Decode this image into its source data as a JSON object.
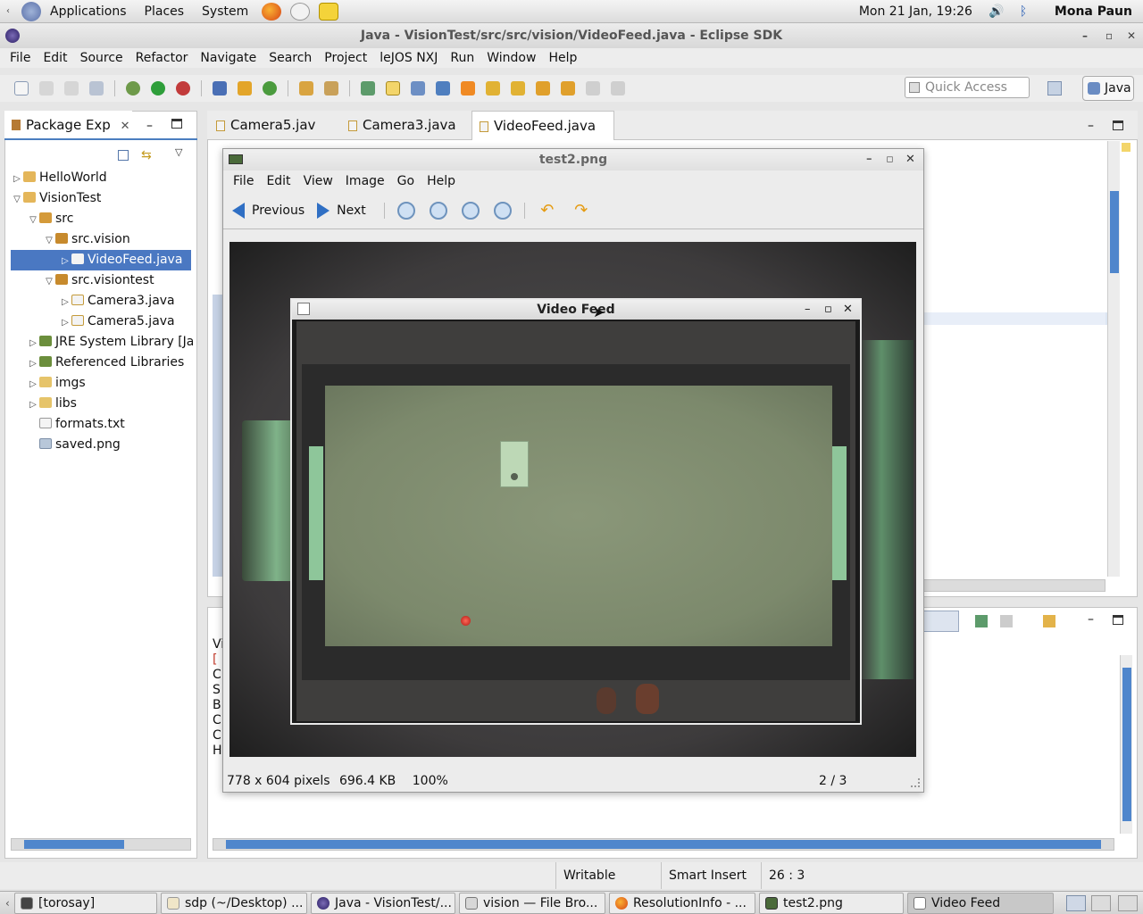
{
  "top_panel": {
    "menus": [
      "Applications",
      "Places",
      "System"
    ],
    "clock": "Mon 21 Jan, 19:26",
    "user": "Mona Paun"
  },
  "eclipse": {
    "title": "Java - VisionTest/src/src/vision/VideoFeed.java - Eclipse SDK",
    "menu": [
      "File",
      "Edit",
      "Source",
      "Refactor",
      "Navigate",
      "Search",
      "Project",
      "leJOS NXJ",
      "Run",
      "Window",
      "Help"
    ],
    "quick_access_placeholder": "Quick Access",
    "perspective": "Java",
    "editor_tabs": [
      "Camera5.jav",
      "Camera3.java",
      "VideoFeed.java"
    ]
  },
  "package_explorer": {
    "title": "Package Exp",
    "items": [
      {
        "label": "HelloWorld"
      },
      {
        "label": "VisionTest"
      },
      {
        "label": "src"
      },
      {
        "label": "src.vision"
      },
      {
        "label": "VideoFeed.java"
      },
      {
        "label": "src.visiontest"
      },
      {
        "label": "Camera3.java"
      },
      {
        "label": "Camera5.java"
      },
      {
        "label": "JRE System Library [Ja"
      },
      {
        "label": "Referenced Libraries"
      },
      {
        "label": "imgs"
      },
      {
        "label": "libs"
      },
      {
        "label": "formats.txt"
      },
      {
        "label": "saved.png"
      }
    ]
  },
  "lower_panel": {
    "letters": [
      "Vi",
      "[",
      "C",
      "S",
      "B",
      "C",
      "C",
      "H"
    ]
  },
  "image_viewer": {
    "title": "test2.png",
    "menu": [
      "File",
      "Edit",
      "View",
      "Image",
      "Go",
      "Help"
    ],
    "previous_label": "Previous",
    "next_label": "Next",
    "status_dims": "778 x 604 pixels",
    "status_size": "696.4 KB",
    "status_zoom": "100%",
    "status_index": "2 / 3"
  },
  "video_feed": {
    "title": "Video Feed"
  },
  "status_bar": {
    "writable": "Writable",
    "insert_mode": "Smart Insert",
    "position": "26 : 3"
  },
  "taskbar": {
    "tasks": [
      {
        "label": "[torosay]",
        "active": false
      },
      {
        "label": "sdp (~/Desktop) ...",
        "active": false
      },
      {
        "label": "Java - VisionTest/...",
        "active": false
      },
      {
        "label": "vision — File Bro...",
        "active": false
      },
      {
        "label": "ResolutionInfo - ...",
        "active": false
      },
      {
        "label": "test2.png",
        "active": false
      },
      {
        "label": "Video Feed",
        "active": true
      }
    ]
  },
  "colors": {
    "selection": "#4a78c2",
    "felt_green": "#7f8d6e",
    "accent_orange": "#e59b11"
  }
}
